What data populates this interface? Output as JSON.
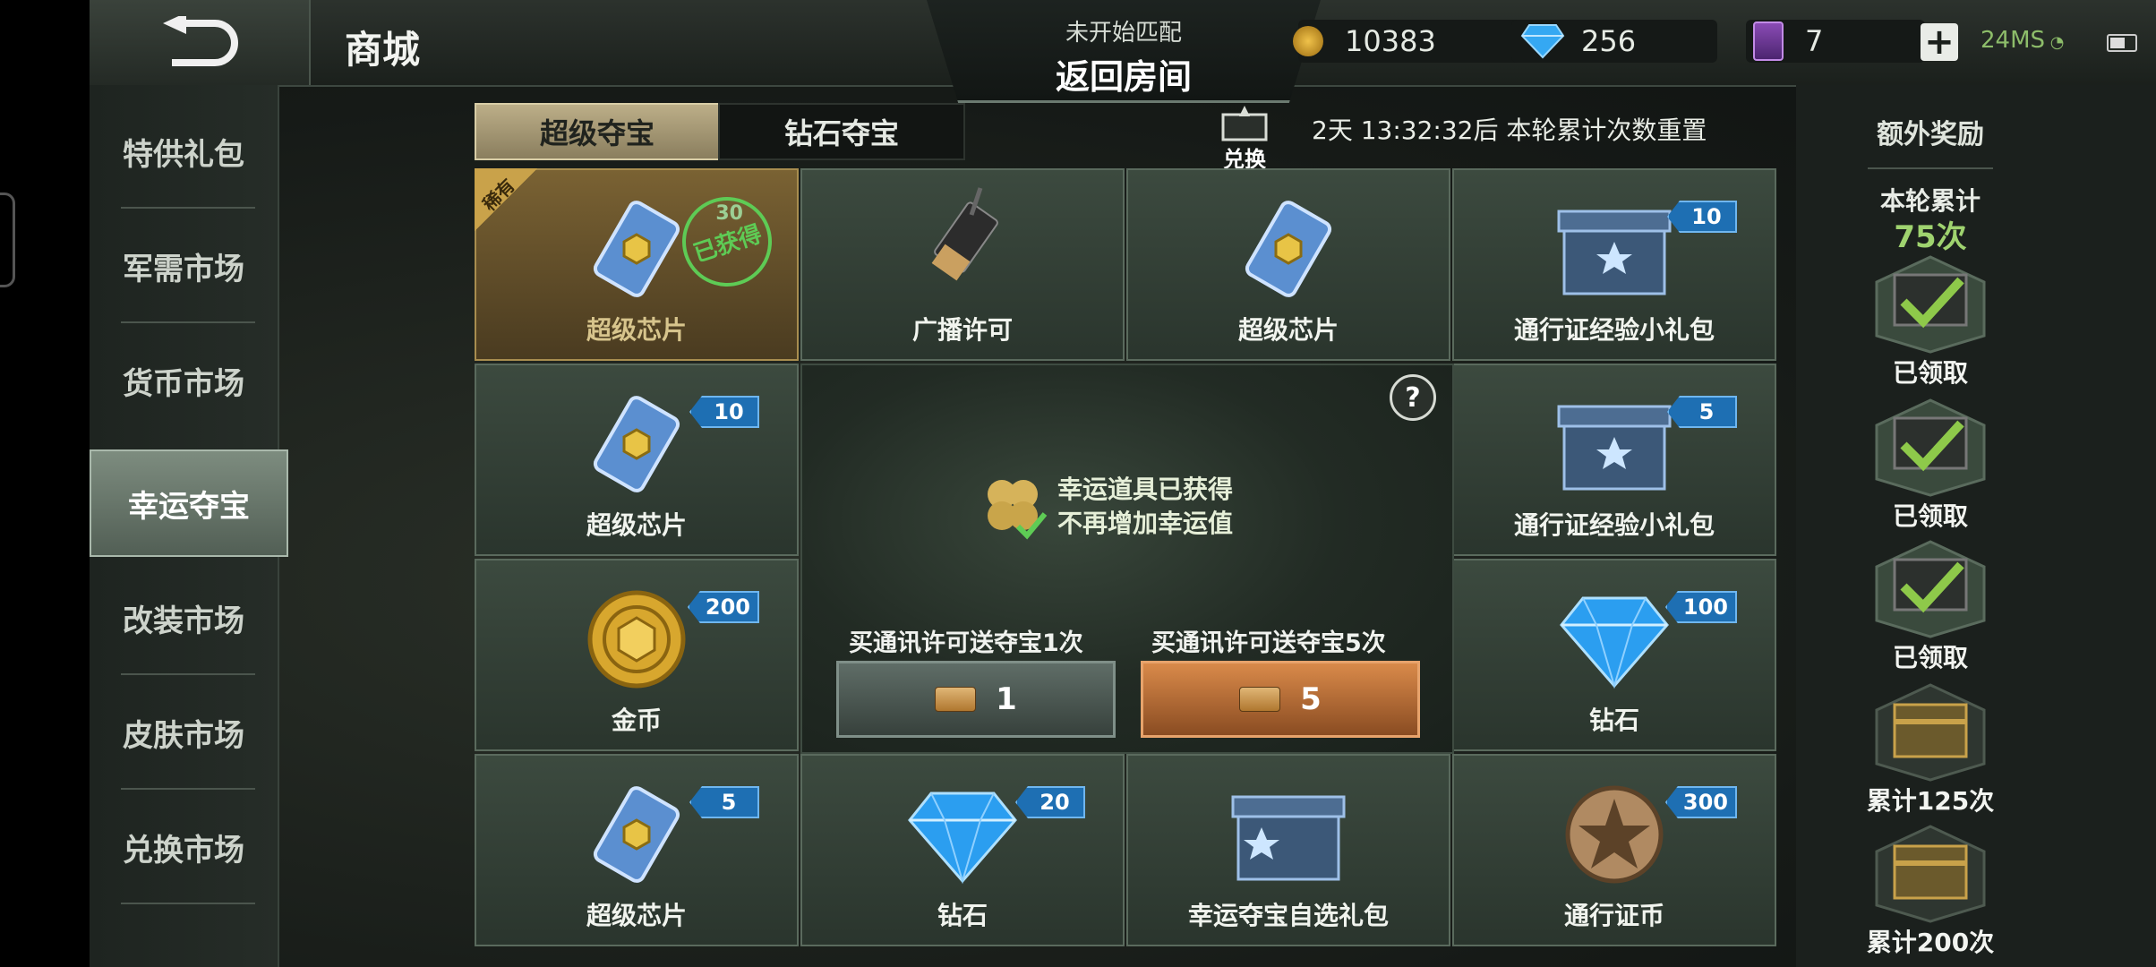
{
  "header": {
    "title": "商城",
    "match_status": "未开始匹配",
    "return_room": "返回房间",
    "gold": "10383",
    "diamonds": "256",
    "tickets": "7",
    "plus": "+",
    "ping": "24MS"
  },
  "sidebar": {
    "items": [
      {
        "label": "特供礼包"
      },
      {
        "label": "军需市场"
      },
      {
        "label": "货币市场"
      },
      {
        "label": "幸运夺宝",
        "active": true
      },
      {
        "label": "改装市场"
      },
      {
        "label": "皮肤市场"
      },
      {
        "label": "兑换市场"
      }
    ]
  },
  "tabs": [
    {
      "label": "超级夺宝",
      "active": true
    },
    {
      "label": "钻石夺宝"
    }
  ],
  "redeem_label": "兑换",
  "reset_text": "2天 13:32:32后 本轮累计次数重置",
  "grid": {
    "cells": [
      {
        "label": "超级芯片",
        "qty": "30",
        "rare_badge": "稀有",
        "obtained": "已获得",
        "icon": "chip-icon"
      },
      {
        "label": "广播许可",
        "qty": "",
        "icon": "radio-icon"
      },
      {
        "label": "超级芯片",
        "qty": "",
        "icon": "chip-icon"
      },
      {
        "label": "通行证经验小礼包",
        "qty": "10",
        "icon": "crate-icon"
      },
      {
        "label": "超级芯片",
        "qty": "10",
        "icon": "chip-icon"
      },
      {
        "label": "通行证经验小礼包",
        "qty": "5",
        "icon": "crate-icon"
      },
      {
        "label": "金币",
        "qty": "200",
        "icon": "gold-coin-icon"
      },
      {
        "label": "钻石",
        "qty": "100",
        "icon": "diamond-icon"
      },
      {
        "label": "超级芯片",
        "qty": "5",
        "icon": "chip-icon"
      },
      {
        "label": "钻石",
        "qty": "20",
        "icon": "diamond-icon"
      },
      {
        "label": "幸运夺宝自选礼包",
        "qty": "",
        "icon": "crate-icon"
      },
      {
        "label": "通行证币",
        "qty": "300",
        "icon": "pass-coin-icon"
      }
    ]
  },
  "center": {
    "help": "?",
    "lucky_line1": "幸运道具已获得",
    "lucky_line2": "不再增加幸运值",
    "buy1_label": "买通讯许可送夺宝1次",
    "buy1_count": "1",
    "buy5_label": "买通讯许可送夺宝5次",
    "buy5_count": "5"
  },
  "right_panel": {
    "title": "额外奖励",
    "cumulative_label": "本轮累计",
    "cumulative_value": "75次",
    "rewards": [
      {
        "label": "已领取",
        "claimed": true
      },
      {
        "label": "已领取",
        "claimed": true
      },
      {
        "label": "已领取",
        "claimed": true
      },
      {
        "label": "累计125次",
        "claimed": false
      },
      {
        "label": "累计200次",
        "claimed": false
      }
    ]
  },
  "colors": {
    "accent_green": "#9fd36f",
    "qty_badge": "#1e6fb3",
    "buy5": "#d98a4a",
    "tab_active": "#bcae88"
  }
}
